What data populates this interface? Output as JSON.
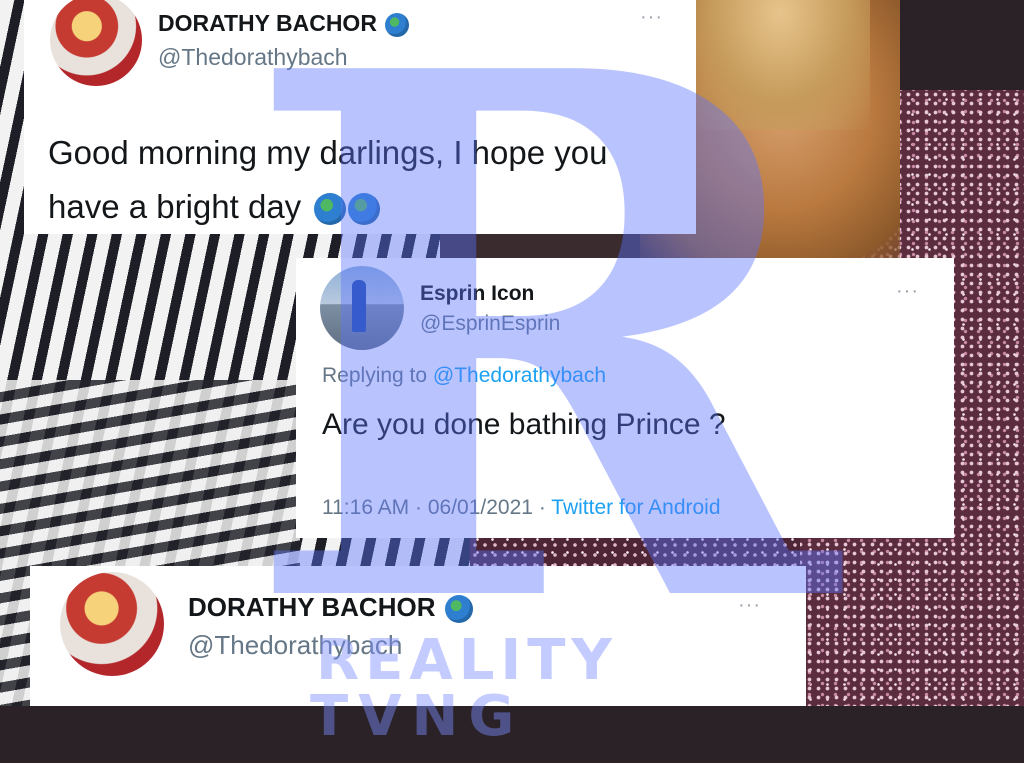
{
  "tweet1": {
    "name": "DORATHY BACHOR",
    "handle": "@Thedorathybach",
    "text_line1": "Good morning my darlings, I hope you",
    "text_line2": "have a bright day",
    "more_icon": "more-dots-icon",
    "name_emoji": "globe-icon",
    "text_emoji_count": 2
  },
  "tweet2": {
    "name": "Esprin Icon",
    "handle": "@EsprinEsprin",
    "replying_prefix": "Replying to ",
    "replying_handle": "@Thedorathybach",
    "text": "Are you done bathing Prince ?",
    "time": "11:16 AM",
    "date": "06/01/2021",
    "separator": "·",
    "source": "Twitter for Android",
    "more_icon": "more-dots-icon"
  },
  "tweet3": {
    "name": "DORATHY BACHOR",
    "handle": "@Thedorathybach",
    "more_icon": "more-dots-icon"
  },
  "watermark": {
    "letter": "R",
    "line1": "REALITY",
    "line2": "TVNG"
  },
  "colors": {
    "link": "#1da1f2",
    "secondary_text": "#657786",
    "watermark": "#5b74ff"
  }
}
